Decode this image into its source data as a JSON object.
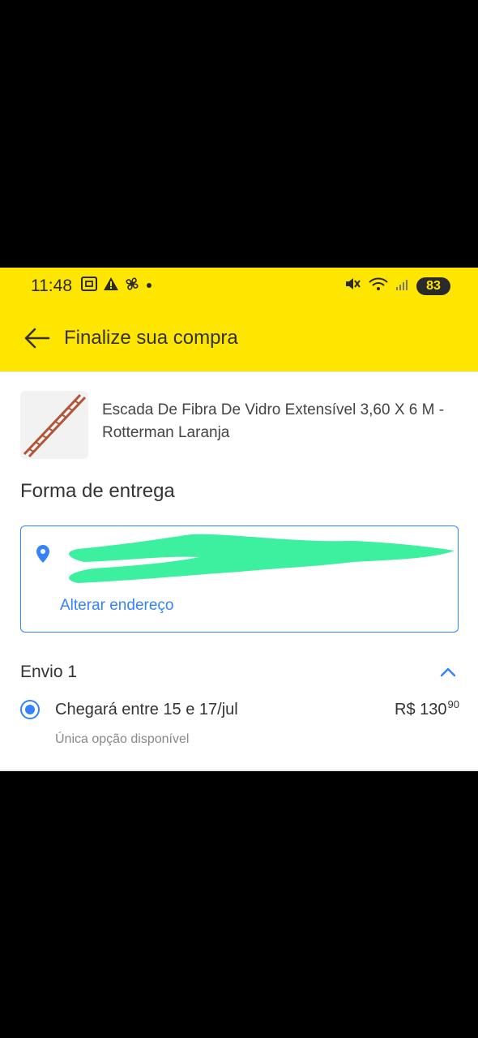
{
  "status_bar": {
    "time": "11:48",
    "battery": "83",
    "left_icons": [
      "screenshot-icon",
      "warning-icon",
      "fan-icon",
      "dot-icon"
    ],
    "right_icons": [
      "mute-icon",
      "wifi-icon",
      "signal-icon",
      "battery-icon"
    ]
  },
  "app_bar": {
    "title": "Finalize sua compra"
  },
  "product": {
    "title": "Escada De Fibra De Vidro Extensível 3,60 X 6 M - Rotterman Laranja"
  },
  "delivery": {
    "section_title": "Forma de entrega",
    "address": {
      "line1": "",
      "line2": "",
      "change_label": "Alterar endereço"
    }
  },
  "shipment": {
    "title": "Envio 1",
    "option": {
      "text": "Chegará entre 15 e 17/jul",
      "price_currency": "R$ 130",
      "price_cents": "90",
      "note": "Única opção disponível",
      "selected": true
    }
  },
  "colors": {
    "brand_yellow": "#ffe600",
    "accent_blue": "#3483fa",
    "redaction_green": "#3df0a0"
  }
}
